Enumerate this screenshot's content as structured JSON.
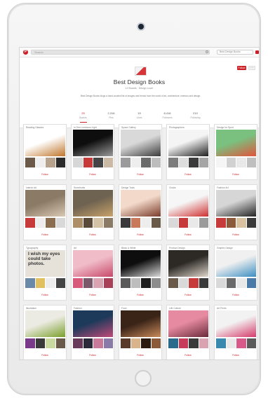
{
  "topbar": {
    "logo_letter": "P",
    "search_placeholder": "Search",
    "user_label": "Best Design Books"
  },
  "header": {
    "follow_label": "Follow",
    "more_label": "···",
    "title": "Best Design Books",
    "meta": "12 Boards · Design Lover",
    "description": "Best Design Books blogs a hand-curated list of images and trends from the world of art, architecture, interiors and design.",
    "stats": [
      {
        "num": "25",
        "label": "Boards",
        "active": true
      },
      {
        "num": "2,316",
        "label": "Pins",
        "active": false
      },
      {
        "num": "15",
        "label": "Likes",
        "active": false
      },
      {
        "num": "8,416",
        "label": "Followers",
        "active": false
      },
      {
        "num": "210",
        "label": "Following",
        "active": false
      }
    ]
  },
  "boards": [
    {
      "title": "Reading Glasses",
      "follow": "Follow",
      "main": [
        "#ffffff",
        "#c0752a"
      ],
      "thumbs": [
        "#6b5a4a",
        "#eeeeee",
        "#b7a28b",
        "#2b2b2b"
      ]
    },
    {
      "title": "In Dim Luminous Light",
      "follow": "Follow",
      "main": [
        "#0e0e0e",
        "#9a9a9a"
      ],
      "thumbs": [
        "#d7d7d7",
        "#c63a3a",
        "#444444",
        "#c9b9a5"
      ]
    },
    {
      "title": "Space Gallery",
      "follow": "Follow",
      "main": [
        "#d9d9d9",
        "#3a3a3a"
      ],
      "thumbs": [
        "#9b9b9b",
        "#eeeeee",
        "#6b6b6b",
        "#bdbdbd"
      ]
    },
    {
      "title": "Photographers",
      "follow": "Follow",
      "main": [
        "#f4f4f4",
        "#1f1f1f"
      ],
      "thumbs": [
        "#7c7c7c",
        "#dddddd",
        "#3c3c3c",
        "#a5a5a5"
      ]
    },
    {
      "title": "Design for Sport",
      "follow": "Follow",
      "main": [
        "#7ac07f",
        "#e3543b"
      ],
      "thumbs": [
        "#f5f5f5",
        "#d1d1d1",
        "#e9e9e9",
        "#bfbfbf"
      ]
    },
    {
      "title": "Interior Art",
      "follow": "Follow",
      "main": [
        "#8a7a66",
        "#d9c9b5"
      ],
      "thumbs": [
        "#c63a3a",
        "#ededed",
        "#8b6d4f",
        "#d9d9d9"
      ]
    },
    {
      "title": "Storefronts",
      "follow": "Follow",
      "main": [
        "#6e6250",
        "#c9a36a"
      ],
      "thumbs": [
        "#ac8f66",
        "#5a4a3a",
        "#d4c2a4",
        "#8a7a66"
      ]
    },
    {
      "title": "Design Tools",
      "follow": "Follow",
      "main": [
        "#f2d9c9",
        "#7a3a2a"
      ],
      "thumbs": [
        "#3a3a3a",
        "#c97a5a",
        "#ededed",
        "#6a5a4a"
      ]
    },
    {
      "title": "Chairs",
      "follow": "Follow",
      "main": [
        "#f6f6f6",
        "#cf2f2f"
      ],
      "thumbs": [
        "#d9d9d9",
        "#c63a3a",
        "#e9e9e9",
        "#9b9b9b"
      ]
    },
    {
      "title": "Fashion Art",
      "follow": "Follow",
      "main": [
        "#d6d6d6",
        "#222222"
      ],
      "thumbs": [
        "#c63a3a",
        "#8b5a3a",
        "#d9c2a0",
        "#3a3a3a"
      ]
    },
    {
      "title": "Typography",
      "follow": "Follow",
      "quote": "I wish my eyes could take photos.",
      "main": [
        "#e6e2da",
        "#333333"
      ],
      "thumbs": [
        "#6a8aa8",
        "#e0c060",
        "#ededed",
        "#444444"
      ]
    },
    {
      "title": "Art",
      "follow": "Follow",
      "main": [
        "#f0bcc8",
        "#c8486a"
      ],
      "thumbs": [
        "#d85a7a",
        "#7a5a6a",
        "#d9a3b1",
        "#a8405a"
      ]
    },
    {
      "title": "Black & White",
      "follow": "Follow",
      "main": [
        "#0e0e0e",
        "#dadada"
      ],
      "thumbs": [
        "#5a5a5a",
        "#bdbdbd",
        "#1f1f1f",
        "#8d8d8d"
      ]
    },
    {
      "title": "Product Design",
      "follow": "Follow",
      "main": [
        "#2d2a26",
        "#e0d7cc"
      ],
      "thumbs": [
        "#6a5a4a",
        "#d9d9d9",
        "#c63a3a",
        "#3a3a3a"
      ]
    },
    {
      "title": "Graphic Design",
      "follow": "Follow",
      "main": [
        "#f0f0f0",
        "#3b8ec2"
      ],
      "thumbs": [
        "#d9d9d9",
        "#6a6a6a",
        "#e9e9e9",
        "#4a7aa8"
      ]
    },
    {
      "title": "Illustration",
      "follow": "Follow",
      "main": [
        "#ecebe3",
        "#7aa02a"
      ],
      "thumbs": [
        "#7a3a8a",
        "#3a3a3a",
        "#c9d9a0",
        "#6a5a4a"
      ]
    },
    {
      "title": "Fashion",
      "follow": "Follow",
      "main": [
        "#1e3a5a",
        "#c04a7a"
      ],
      "thumbs": [
        "#6a3a5a",
        "#2a2a3a",
        "#c97a9a",
        "#8a7aa8"
      ]
    },
    {
      "title": "Food",
      "follow": "Follow",
      "main": [
        "#3a2418",
        "#c98a5a"
      ],
      "thumbs": [
        "#5a3a2a",
        "#d9b38a",
        "#2a1a10",
        "#8a5a3a"
      ]
    },
    {
      "title": "Life Culture",
      "follow": "Follow",
      "main": [
        "#e58aa0",
        "#6a2a3a"
      ],
      "thumbs": [
        "#2a6a8a",
        "#c63a5a",
        "#3a3a3a",
        "#d9a3b1"
      ]
    },
    {
      "title": "Art Prints",
      "follow": "Follow",
      "main": [
        "#f2f2f2",
        "#d63a6a"
      ],
      "thumbs": [
        "#3a8ab0",
        "#e9e9e9",
        "#d85a8a",
        "#5a5a5a"
      ]
    }
  ],
  "colors": {
    "brand_red": "#cb2027",
    "screen_bg": "#efefef",
    "device_body": "#f1f1f1"
  }
}
